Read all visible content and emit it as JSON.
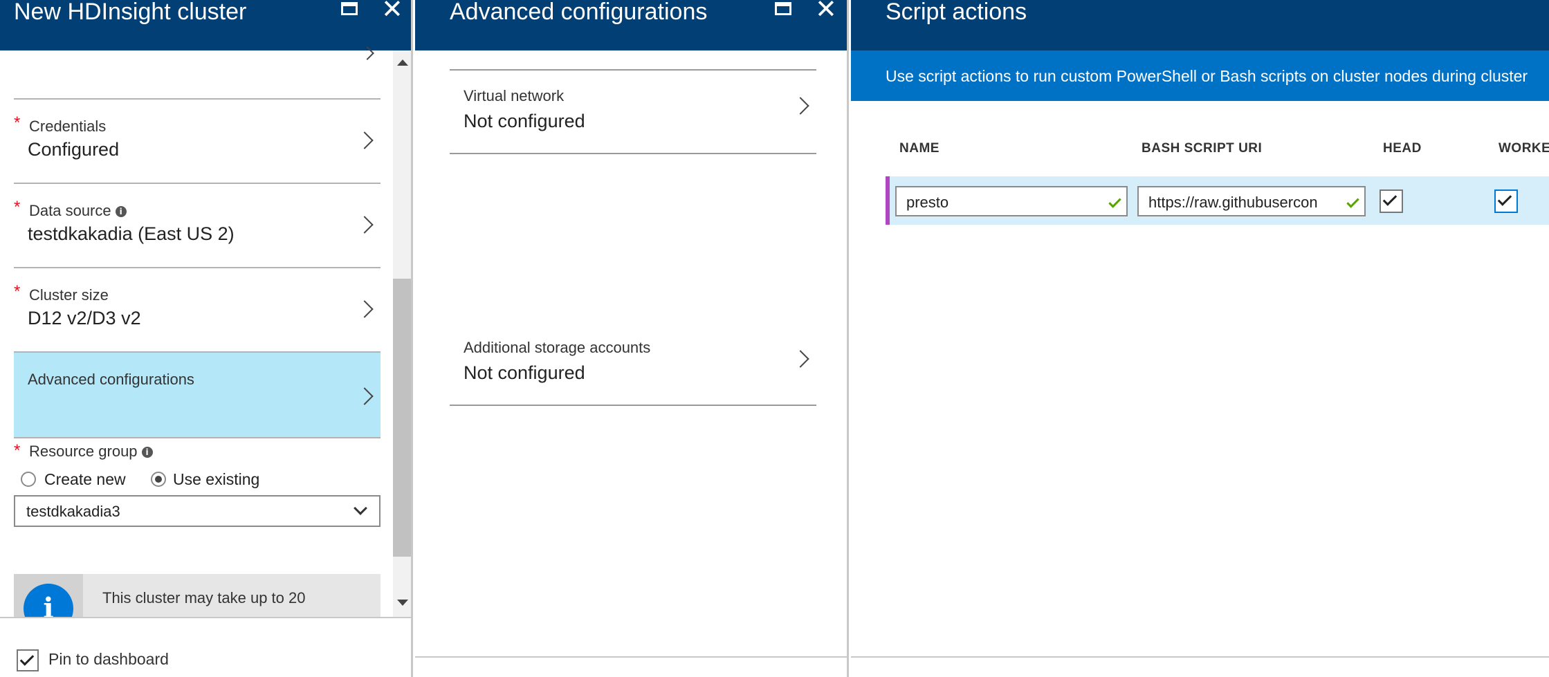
{
  "blade1": {
    "title": "New HDInsight cluster",
    "rows": [
      {
        "label": "Credentials",
        "value": "Configured",
        "required": true
      },
      {
        "label": "Data source",
        "value": "testdkakadia (East US 2)",
        "required": true,
        "info": true
      },
      {
        "label": "Cluster size",
        "value": "D12 v2/D3 v2",
        "required": true
      },
      {
        "label": "Advanced configurations",
        "value": "",
        "selected": true
      }
    ],
    "resource_group": {
      "label": "Resource group",
      "options": [
        "Create new",
        "Use existing"
      ],
      "selected": "Use existing",
      "select_value": "testdkakadia3"
    },
    "notice_text": "This cluster may take up to 20",
    "pin_label": "Pin to dashboard",
    "pin_checked": true
  },
  "blade2": {
    "title": "Advanced configurations",
    "rows": [
      {
        "label": "Virtual network",
        "value": "Not configured"
      },
      {
        "label": "Additional storage accounts",
        "value": "Not configured"
      }
    ]
  },
  "blade3": {
    "title": "Script actions",
    "banner": "Use script actions to run custom PowerShell or Bash scripts on cluster nodes during cluster",
    "columns": [
      "NAME",
      "BASH SCRIPT URI",
      "HEAD",
      "WORKER"
    ],
    "rows": [
      {
        "name": "presto",
        "uri": "https://raw.githubusercon",
        "head": true,
        "worker": true
      }
    ]
  },
  "icons": {
    "maximize": "maximize-icon",
    "close": "close-icon",
    "chevron": "chevron-right-icon",
    "info": "info-icon",
    "checkmark": "checkmark-icon"
  },
  "colors": {
    "header": "#013f74",
    "banner": "#0072c6",
    "selected_row": "#b4e7f7",
    "required": "#e81123",
    "valid": "#57a300",
    "row_accent": "#b146c2"
  }
}
